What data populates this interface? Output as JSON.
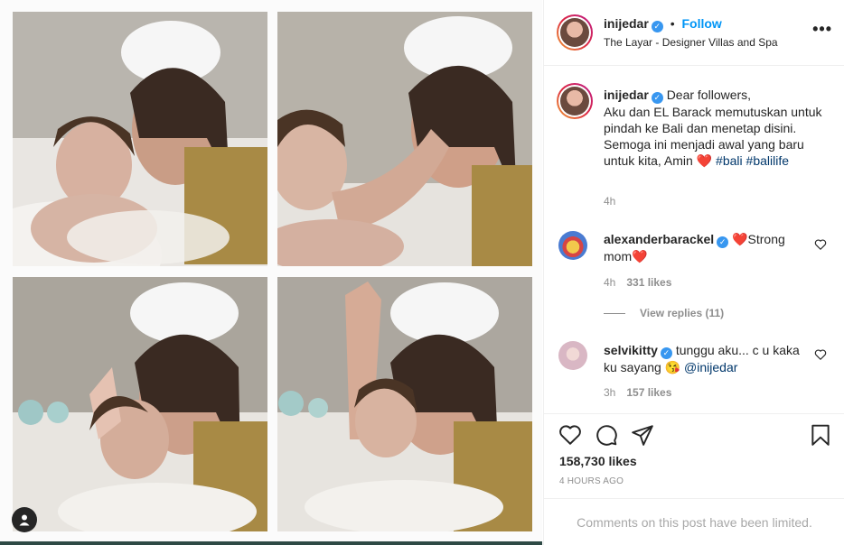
{
  "post": {
    "likes": "158,730 likes",
    "posted": "4 HOURS AGO",
    "limited_notice": "Comments on this post have been limited."
  },
  "author": {
    "username": "inijedar",
    "follow_label": "Follow",
    "separator": "•",
    "location": "The Layar - Designer Villas and Spa"
  },
  "caption": {
    "username": "inijedar",
    "text_1": "Dear followers,",
    "text_2": "Aku dan EL Barack memutuskan untuk pindah ke Bali dan menetap disini. Semoga ini menjadi awal yang baru untuk kita, Amin ",
    "heart": "❤️",
    "hashtag_1": "#bali",
    "hashtag_2": "#balilife",
    "time": "4h"
  },
  "comments": [
    {
      "username": "alexanderbarackel",
      "text_pre": "❤️Strong mom",
      "heart": "❤️",
      "time": "4h",
      "likes": "331 likes",
      "view_replies": "View replies (11)"
    },
    {
      "username": "selvikitty",
      "text_pre": "tunggu aku... c u kaka ku sayang ",
      "emoji": "😘",
      "mention": "@inijedar",
      "time": "3h",
      "likes": "157 likes"
    }
  ],
  "icons": {
    "more": "•••",
    "verified": "✓",
    "like": "heart-icon",
    "comment": "comment-icon",
    "share": "share-icon",
    "save": "bookmark-icon",
    "tag": "user-tag-icon"
  },
  "colors": {
    "link_blue": "#0095f6",
    "verified_blue": "#3897f0",
    "hashtag": "#00376b",
    "muted": "#8e8e8e",
    "heart_red": "#ed4956"
  }
}
